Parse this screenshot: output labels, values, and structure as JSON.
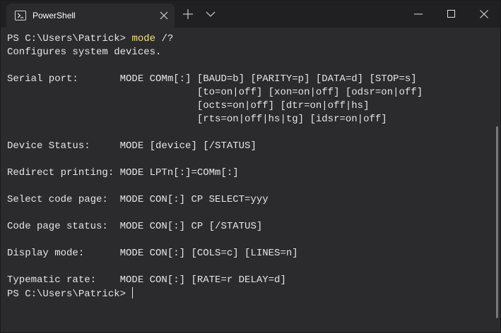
{
  "tab": {
    "title": "PowerShell",
    "icon": "powershell-icon"
  },
  "titlebar": {
    "new_tab_icon": "plus-icon",
    "dropdown_icon": "chevron-down-icon",
    "controls": [
      "minimize-icon",
      "maximize-icon",
      "close-icon"
    ]
  },
  "colors": {
    "background": "#2b2b2e",
    "titlebar": "#202023",
    "text": "#e6e6e6",
    "command_highlight": "#f0e27a"
  },
  "terminal": {
    "prompt": "PS C:\\Users\\Patrick> ",
    "command": "mode",
    "command_args": " /?",
    "lines": [
      "Configures system devices.",
      "",
      "Serial port:       MODE COMm[:] [BAUD=b] [PARITY=p] [DATA=d] [STOP=s]",
      "                                [to=on|off] [xon=on|off] [odsr=on|off]",
      "                                [octs=on|off] [dtr=on|off|hs]",
      "                                [rts=on|off|hs|tg] [idsr=on|off]",
      "",
      "Device Status:     MODE [device] [/STATUS]",
      "",
      "Redirect printing: MODE LPTn[:]=COMm[:]",
      "",
      "Select code page:  MODE CON[:] CP SELECT=yyy",
      "",
      "Code page status:  MODE CON[:] CP [/STATUS]",
      "",
      "Display mode:      MODE CON[:] [COLS=c] [LINES=n]",
      "",
      "Typematic rate:    MODE CON[:] [RATE=r DELAY=d]"
    ],
    "final_prompt": "PS C:\\Users\\Patrick> "
  }
}
